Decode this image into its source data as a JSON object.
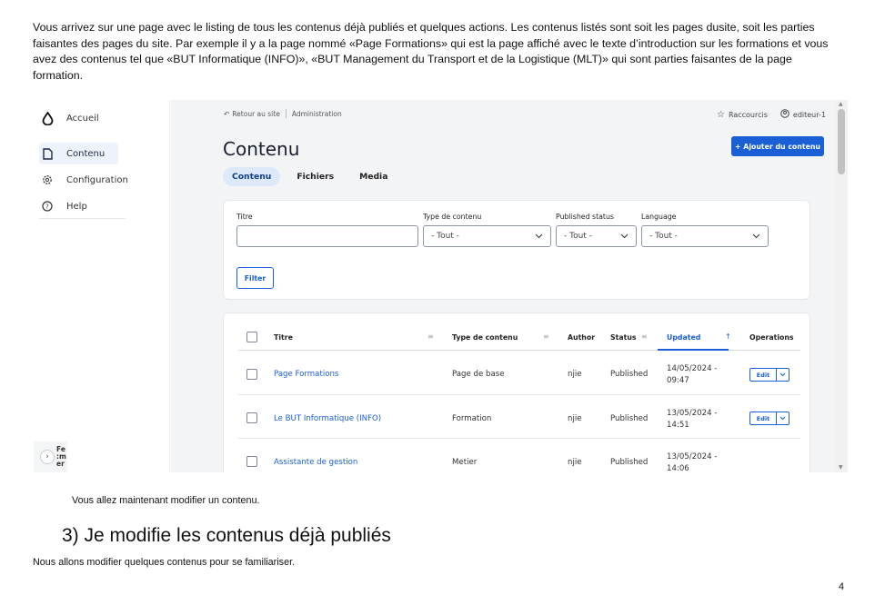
{
  "document": {
    "intro_paragraph": "Vous arrivez sur une page avec le listing de tous les contenus déjà publiés et quelques actions. Les contenus listés sont soit les pages dusite, soit les parties faisantes des pages du site. Par exemple il y a la page nommé «Page Formations» qui est la page affiché avec le texte d’introduction sur les formations et vous avez des contenus tel que «BUT Informatique (INFO)», «BUT Management du Transport et de la Logistique (MLT)» qui sont parties faisantes de la page formation.",
    "after_screenshot": "Vous allez maintenant modifier un contenu.",
    "section_heading": "3) Je modifie les contenus déjà publiés",
    "section_text": "Nous allons modifier quelques contenus pour se familiariser.",
    "page_number": "4"
  },
  "sidebar": {
    "items": [
      {
        "label": "Accueil",
        "icon": "drop-icon"
      },
      {
        "label": "Contenu",
        "icon": "document-icon"
      },
      {
        "label": "Configuration",
        "icon": "gear-icon"
      },
      {
        "label": "Help",
        "icon": "help-icon"
      }
    ],
    "collapse_label": "Fe\nrm\ner"
  },
  "topbar": {
    "back_label": "Retour au site",
    "admin_label": "Administration",
    "shortcuts_label": "Raccourcis",
    "user_label": "editeur-1"
  },
  "main": {
    "title": "Contenu",
    "add_button": "+ Ajouter du contenu",
    "tabs": [
      "Contenu",
      "Fichiers",
      "Media"
    ]
  },
  "filters": {
    "title_label": "Titre",
    "title_value": "",
    "type_label": "Type de contenu",
    "type_value": "- Tout -",
    "status_label": "Published status",
    "status_value": "- Tout -",
    "language_label": "Language",
    "language_value": "- Tout -",
    "filter_button": "Filter"
  },
  "table": {
    "headers": {
      "title": "Titre",
      "type": "Type de contenu",
      "author": "Author",
      "status": "Status",
      "updated": "Updated",
      "operations": "Operations"
    },
    "edit_label": "Edit",
    "rows": [
      {
        "title": "Page Formations",
        "type": "Page de base",
        "author": "njie",
        "status": "Published",
        "updated_date": "14/05/2024 -",
        "updated_time": "09:47"
      },
      {
        "title": "Le BUT Informatique (INFO)",
        "type": "Formation",
        "author": "njie",
        "status": "Published",
        "updated_date": "13/05/2024 -",
        "updated_time": "14:51"
      },
      {
        "title": "Assistante de gestion",
        "type": "Metier",
        "author": "njie",
        "status": "Published",
        "updated_date": "13/05/2024 -",
        "updated_time": "14:06"
      }
    ]
  },
  "colors": {
    "accent": "#1a5fd6",
    "tab_active_bg": "#dde9f8",
    "panel_bg": "#f3f4f6"
  }
}
